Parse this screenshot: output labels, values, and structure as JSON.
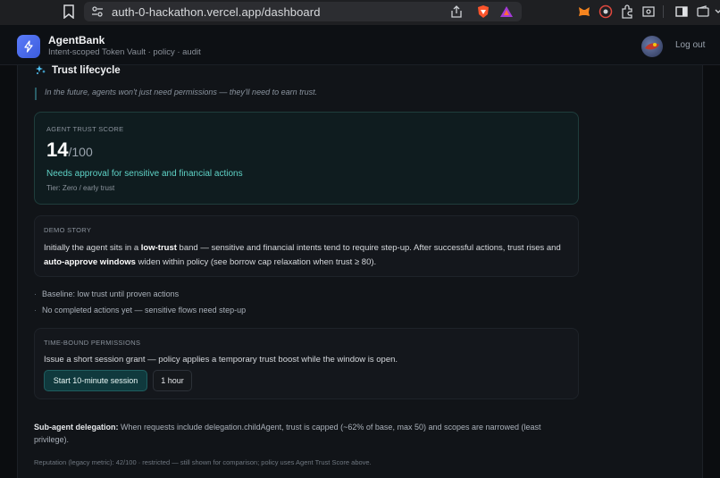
{
  "browser": {
    "url": "auth-0-hackathon.vercel.app/dashboard"
  },
  "header": {
    "app_name": "AgentBank",
    "subtitle": "Intent-scoped Token Vault · policy · audit",
    "logout_label": "Log out"
  },
  "section": {
    "title": "Trust lifecycle",
    "quote": "In the future, agents won't just need permissions — they'll need to earn trust."
  },
  "score_card": {
    "label": "AGENT TRUST SCORE",
    "score": "14",
    "denominator": "/100",
    "status": "Needs approval for sensitive and financial actions",
    "tier": "Tier: Zero / early trust"
  },
  "story": {
    "label": "DEMO STORY",
    "text_1": "Initially the agent sits in a ",
    "bold_1": "low-trust",
    "text_2": " band — sensitive and financial intents tend to require step-up. After successful actions, trust rises and ",
    "bold_2": "auto-approve windows",
    "text_3": " widen within policy (see borrow cap relaxation when trust ≥ 80)."
  },
  "bullets": [
    "Baseline: low trust until proven actions",
    "No completed actions yet — sensitive flows need step-up"
  ],
  "time_bound": {
    "label": "TIME-BOUND PERMISSIONS",
    "text": "Issue a short session grant — policy applies a temporary trust boost while the window is open.",
    "start_button": "Start 10-minute session",
    "duration_option": "1 hour"
  },
  "delegation": {
    "bold": "Sub-agent delegation:",
    "text": " When requests include delegation.childAgent, trust is capped (~62% of base, max 50) and scopes are narrowed (least privilege)."
  },
  "reputation_note": "Reputation (legacy metric): 42/100 · restricted — still shown for comparison; policy uses Agent Trust Score above.",
  "colors": {
    "accent_teal": "#5fd3c7",
    "brand_blue": "#4c6ef5",
    "background": "#0b0d10"
  }
}
